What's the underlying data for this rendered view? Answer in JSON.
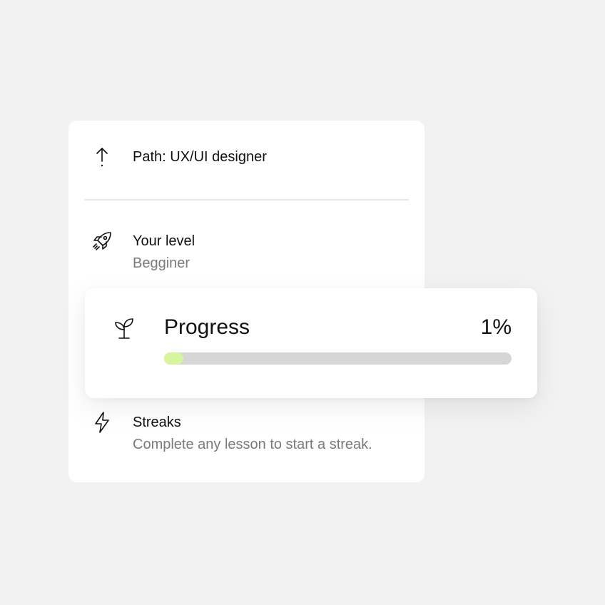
{
  "path": {
    "icon": "arrow-up-icon",
    "label": "Path: UX/UI designer"
  },
  "level": {
    "icon": "rocket-icon",
    "title": "Your level",
    "value": "Begginer"
  },
  "progress": {
    "icon": "sprout-icon",
    "title": "Progress",
    "percent_label": "1%",
    "value": 0.01,
    "fill_color": "#d7f59a",
    "track_color": "#d6d6d6"
  },
  "streaks": {
    "icon": "lightning-icon",
    "title": "Streaks",
    "description": "Complete any lesson to start a streak."
  },
  "colors": {
    "background": "#f2f2f2",
    "card": "#ffffff",
    "text": "#111111",
    "muted": "#7a7a7e"
  }
}
